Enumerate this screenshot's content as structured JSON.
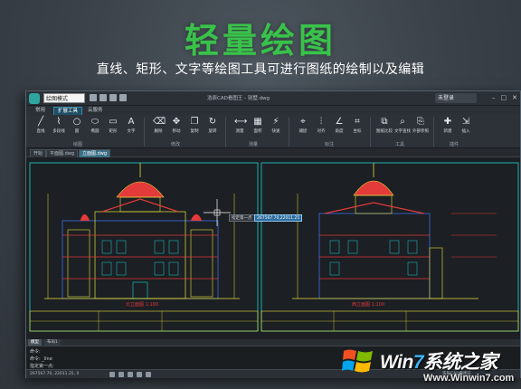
{
  "promo": {
    "title": "轻量绘图",
    "subtitle": "直线、矩形、文字等绘图工具可进行图纸的绘制以及编辑"
  },
  "colors": {
    "accent_green": "#39c24a",
    "cad_cyan": "#19d6d6",
    "cad_red": "#e33a3a",
    "cad_yellow": "#e6e13a",
    "cad_blue": "#3b6fe3"
  },
  "titlebar": {
    "mode": "绘图模式",
    "window_title": "浩辰CAD看图王 - 别墅.dwg",
    "login": "未登录"
  },
  "menu_tabs": [
    {
      "label": "常用"
    },
    {
      "label": "扩展工具"
    },
    {
      "label": "云服务"
    }
  ],
  "ribbon": {
    "tools": [
      {
        "label": "直线",
        "icon": "line-icon"
      },
      {
        "label": "多段线",
        "icon": "polyline-icon"
      },
      {
        "label": "圆",
        "icon": "circle-icon"
      },
      {
        "label": "椭圆",
        "icon": "ellipse-icon"
      },
      {
        "label": "矩形",
        "icon": "rectangle-icon"
      },
      {
        "label": "文字",
        "icon": "text-icon"
      },
      {
        "label": "删除",
        "icon": "erase-icon"
      },
      {
        "label": "移动",
        "icon": "move-icon"
      },
      {
        "label": "复制",
        "icon": "copy-icon"
      },
      {
        "label": "旋转",
        "icon": "rotate-icon"
      },
      {
        "label": "测量",
        "icon": "measure-icon"
      },
      {
        "label": "面积",
        "icon": "area-icon"
      },
      {
        "label": "快速",
        "icon": "quick-icon"
      },
      {
        "label": "捕捉",
        "icon": "snap-icon"
      },
      {
        "label": "对齐",
        "icon": "align-icon"
      },
      {
        "label": "角度",
        "icon": "angle-icon"
      },
      {
        "label": "坐标",
        "icon": "coordinate-icon"
      },
      {
        "label": "图纸比较",
        "icon": "compare-icon"
      },
      {
        "label": "文字查找",
        "icon": "find-text-icon"
      },
      {
        "label": "外部参照",
        "icon": "xref-icon"
      },
      {
        "label": "新建",
        "icon": "new-icon"
      },
      {
        "label": "插入",
        "icon": "insert-icon"
      }
    ],
    "groups": [
      "绘图",
      "修改",
      "测量",
      "标注",
      "工具",
      "插件"
    ]
  },
  "doc_tabs": [
    {
      "label": "开始"
    },
    {
      "label": "平面图.dwg"
    },
    {
      "label": "立面图.dwg"
    }
  ],
  "canvas": {
    "tooltip": "指定第一点",
    "coord_input": "267567.70,22011.25",
    "left_sheet_label": "北立面图 1:100",
    "right_sheet_label": "西立面图 1:100"
  },
  "layout_tabs": [
    {
      "label": "模型"
    },
    {
      "label": "布局1"
    }
  ],
  "command": {
    "line1": "命令:",
    "line2": "命令: _line",
    "line3": "指定第一点:"
  },
  "status": {
    "coords": "267567.70, 22011.25, 0",
    "right": "浩辰CAD看图王"
  },
  "watermark": {
    "brand_part1": "Win",
    "brand_part2": "7",
    "brand_part3": "系统之家",
    "url": "Www.Winwin7.com"
  }
}
